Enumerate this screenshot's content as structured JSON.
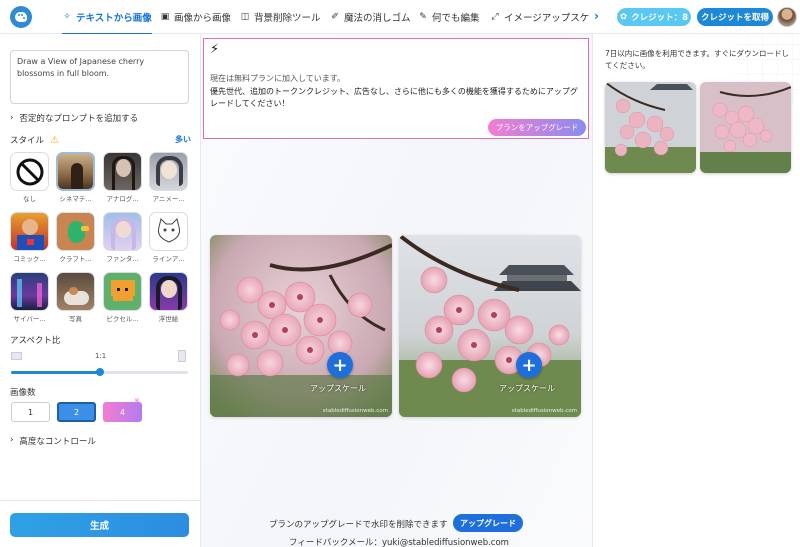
{
  "nav": {
    "tabs": [
      {
        "label": "テキストから画像",
        "icon": "magic-wand-icon",
        "glyph": "✧"
      },
      {
        "label": "画像から画像",
        "icon": "image-icon",
        "glyph": "▣"
      },
      {
        "label": "背景削除ツール",
        "icon": "layers-icon",
        "glyph": "◫"
      },
      {
        "label": "魔法の消しゴム",
        "icon": "eraser-icon",
        "glyph": "✐"
      },
      {
        "label": "何でも編集",
        "icon": "edit-icon",
        "glyph": "✎"
      },
      {
        "label": "イメージアップスケ",
        "icon": "expand-icon",
        "glyph": "⤢"
      }
    ],
    "more_arrow": "›",
    "credits_label": "クレジット：8",
    "get_credits_label": "クレジットを取得"
  },
  "left": {
    "prompt_text": "Draw a View of Japanese cherry blossoms in full bloom.",
    "negative_prompt_label": "否定的なプロンプトを追加する",
    "style_label": "スタイル",
    "more_label": "多い",
    "styles": [
      {
        "name": "なし",
        "selected": false
      },
      {
        "name": "シネマテ...",
        "selected": true
      },
      {
        "name": "アナログ...",
        "selected": false
      },
      {
        "name": "アニメー...",
        "selected": false
      },
      {
        "name": "コミック...",
        "selected": false
      },
      {
        "name": "クラフト...",
        "selected": false
      },
      {
        "name": "ファンタ...",
        "selected": false
      },
      {
        "name": "ラインア...",
        "selected": false
      },
      {
        "name": "サイバー...",
        "selected": false
      },
      {
        "name": "写真",
        "selected": false
      },
      {
        "name": "ピクセル...",
        "selected": false
      },
      {
        "name": "浮世絵",
        "selected": false
      }
    ],
    "aspect_label": "アスペクト比",
    "aspect_value": "1:1",
    "aspect_slider_fraction": 0.5,
    "count_label": "画像数",
    "counts": [
      "1",
      "2",
      "4"
    ],
    "count_selected": "2",
    "advanced_label": "高度なコントロール",
    "generate_label": "生成"
  },
  "banner": {
    "line1": "現在は無料プランに加入しています。",
    "line2": "優先世代、追加のトークンクレジット、広告なし、さらに他にも多くの機能を獲得するためにアップグレードしてください！",
    "button": "プランをアップグレード"
  },
  "results": {
    "upscale_label": "アップスケール",
    "watermark": "stablediffusionweb.com",
    "watermark_note": "プランのアップグレードで水印を削除できます",
    "watermark_button": "アップグレード",
    "feedback": "フィードバックメール：yuki@stablediffusionweb.com"
  },
  "history": {
    "note": "7日以内に画像を利用できます。すぐにダウンロードしてください。"
  },
  "colors": {
    "accent": "#1673d6",
    "banner_border": "#dc6fb6",
    "credit_pill": "#5ac8f2",
    "upgrade_gradient_start": "#f37cd2",
    "upgrade_gradient_end": "#8a8cf0"
  }
}
